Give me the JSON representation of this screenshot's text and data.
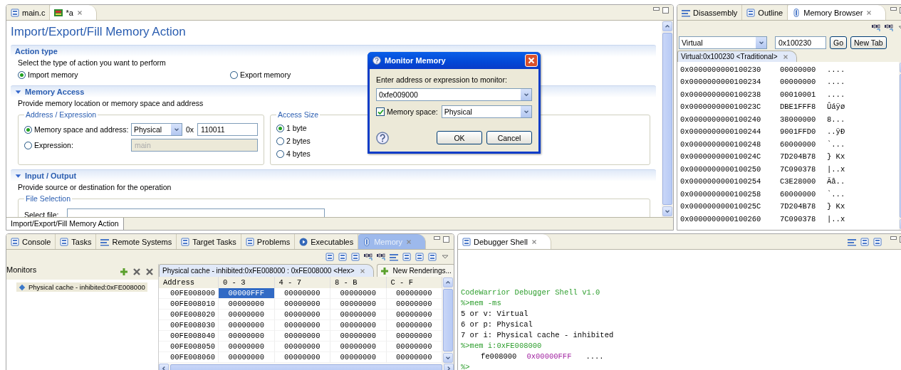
{
  "editor": {
    "tabs": [
      {
        "label": "main.c",
        "selected": false
      },
      {
        "label": "*a",
        "selected": true
      }
    ],
    "title": "Import/Export/Fill Memory Action",
    "action_type": {
      "title": "Action type",
      "description": "Select the type of action you want to perform",
      "options": [
        {
          "label": "Import memory",
          "selected": true
        },
        {
          "label": "Export memory",
          "selected": false
        }
      ]
    },
    "memory_access": {
      "title": "Memory Access",
      "expanded": true,
      "description": "Provide memory location or memory space and address",
      "address_group": {
        "title": "Address / Expression",
        "space_option": {
          "label": "Memory space and address:",
          "selected": true
        },
        "space_value": "Physical",
        "prefix": "0x",
        "address": "110011",
        "expression_option": {
          "label": "Expression:",
          "selected": false
        },
        "expression_value": "main",
        "expression_disabled": true
      },
      "size_group": {
        "title": "Access Size",
        "options": [
          {
            "label": "1 byte",
            "selected": true
          },
          {
            "label": "2 bytes",
            "selected": false
          },
          {
            "label": "4 bytes",
            "selected": false
          }
        ]
      }
    },
    "input_output": {
      "title": "Input / Output",
      "expanded": true,
      "description": "Provide source or destination for the operation",
      "file_group": {
        "title": "File Selection",
        "label": "Select file:"
      }
    },
    "page_tab": "Import/Export/Fill Memory Action"
  },
  "dialog": {
    "title": "Monitor Memory",
    "prompt": "Enter address or expression to monitor:",
    "expression": "0xfe009000",
    "space_checked": true,
    "space_label": "Memory space:",
    "space_value": "Physical",
    "buttons": [
      "OK",
      "Cancel"
    ]
  },
  "memory_browser": {
    "tabs": [
      {
        "label": "Disassembly",
        "selected": false
      },
      {
        "label": "Outline",
        "selected": false
      },
      {
        "label": "Memory Browser",
        "selected": true
      }
    ],
    "space": "Virtual",
    "address": "0x100230",
    "buttons": [
      "Go",
      "New Tab"
    ],
    "rendering_tab": "Virtual:0x100230 <Traditional>",
    "rows": [
      {
        "address": "0x0000000000100230",
        "value": "00000000",
        "ascii": "...."
      },
      {
        "address": "0x0000000000100234",
        "value": "00000000",
        "ascii": "...."
      },
      {
        "address": "0x0000000000100238",
        "value": "00010001",
        "ascii": "...."
      },
      {
        "address": "0x000000000010023C",
        "value": "DBE1FFF8",
        "ascii": "Ûáÿø"
      },
      {
        "address": "0x0000000000100240",
        "value": "38000000",
        "ascii": "8..."
      },
      {
        "address": "0x0000000000100244",
        "value": "9001FFD0",
        "ascii": "..ÿÐ"
      },
      {
        "address": "0x0000000000100248",
        "value": "60000000",
        "ascii": "`..."
      },
      {
        "address": "0x000000000010024C",
        "value": "7D204B78",
        "ascii": "} Kx"
      },
      {
        "address": "0x0000000000100250",
        "value": "7C090378",
        "ascii": "|..x"
      },
      {
        "address": "0x0000000000100254",
        "value": "C3E28000",
        "ascii": "Ãâ.."
      },
      {
        "address": "0x0000000000100258",
        "value": "60000000",
        "ascii": "`..."
      },
      {
        "address": "0x000000000010025C",
        "value": "7D204B78",
        "ascii": "} Kx"
      },
      {
        "address": "0x0000000000100260",
        "value": "7C090378",
        "ascii": "|..x"
      }
    ]
  },
  "memory_view": {
    "tabs": [
      {
        "label": "Console",
        "selected": false
      },
      {
        "label": "Tasks",
        "selected": false
      },
      {
        "label": "Remote Systems",
        "selected": false
      },
      {
        "label": "Target Tasks",
        "selected": false
      },
      {
        "label": "Problems",
        "selected": false
      },
      {
        "label": "Executables",
        "selected": false
      },
      {
        "label": "Memory",
        "selected": true
      }
    ],
    "monitors_title": "Monitors",
    "monitors": [
      {
        "label": "Physical cache - inhibited:0xFE008000",
        "selected": true
      }
    ],
    "rendering_tab": "Physical cache - inhibited:0xFE008000 : 0xFE008000 <Hex>",
    "new_renderings": "New Renderings...",
    "columns": [
      "Address",
      "0 - 3",
      "4 - 7",
      "8 - B",
      "C - F"
    ],
    "rows": [
      {
        "cells": [
          {
            "value": "00FE008000",
            "selected": false
          },
          {
            "value": "00000FFF",
            "selected": true
          },
          {
            "value": "00000000",
            "selected": false
          },
          {
            "value": "00000000",
            "selected": false
          },
          {
            "value": "00000000",
            "selected": false
          }
        ]
      },
      {
        "cells": [
          {
            "value": "00FE008010",
            "selected": false
          },
          {
            "value": "00000000",
            "selected": false
          },
          {
            "value": "00000000",
            "selected": false
          },
          {
            "value": "00000000",
            "selected": false
          },
          {
            "value": "00000000",
            "selected": false
          }
        ]
      },
      {
        "cells": [
          {
            "value": "00FE008020",
            "selected": false
          },
          {
            "value": "00000000",
            "selected": false
          },
          {
            "value": "00000000",
            "selected": false
          },
          {
            "value": "00000000",
            "selected": false
          },
          {
            "value": "00000000",
            "selected": false
          }
        ]
      },
      {
        "cells": [
          {
            "value": "00FE008030",
            "selected": false
          },
          {
            "value": "00000000",
            "selected": false
          },
          {
            "value": "00000000",
            "selected": false
          },
          {
            "value": "00000000",
            "selected": false
          },
          {
            "value": "00000000",
            "selected": false
          }
        ]
      },
      {
        "cells": [
          {
            "value": "00FE008040",
            "selected": false
          },
          {
            "value": "00000000",
            "selected": false
          },
          {
            "value": "00000000",
            "selected": false
          },
          {
            "value": "00000000",
            "selected": false
          },
          {
            "value": "00000000",
            "selected": false
          }
        ]
      },
      {
        "cells": [
          {
            "value": "00FE008050",
            "selected": false
          },
          {
            "value": "00000000",
            "selected": false
          },
          {
            "value": "00000000",
            "selected": false
          },
          {
            "value": "00000000",
            "selected": false
          },
          {
            "value": "00000000",
            "selected": false
          }
        ]
      },
      {
        "cells": [
          {
            "value": "00FE008060",
            "selected": false
          },
          {
            "value": "00000000",
            "selected": false
          },
          {
            "value": "00000000",
            "selected": false
          },
          {
            "value": "00000000",
            "selected": false
          },
          {
            "value": "00000000",
            "selected": false
          }
        ]
      }
    ]
  },
  "shell": {
    "title": "Debugger Shell",
    "lines": [
      {
        "kind": "banner",
        "text": "CodeWarrior Debugger Shell v1.0"
      },
      {
        "kind": "input",
        "text": "%>mem -ms"
      },
      {
        "kind": "output",
        "text": "5 or v: Virtual"
      },
      {
        "kind": "output",
        "text": "6 or p: Physical"
      },
      {
        "kind": "output",
        "text": "7 or i: Physical cache - inhibited"
      },
      {
        "kind": "input",
        "text": "%>mem i:0xFE008000"
      },
      {
        "kind": "result",
        "address": "fe008000",
        "value": "0x00000FFF",
        "ascii": "...."
      },
      {
        "kind": "input",
        "text": "%>"
      }
    ]
  }
}
